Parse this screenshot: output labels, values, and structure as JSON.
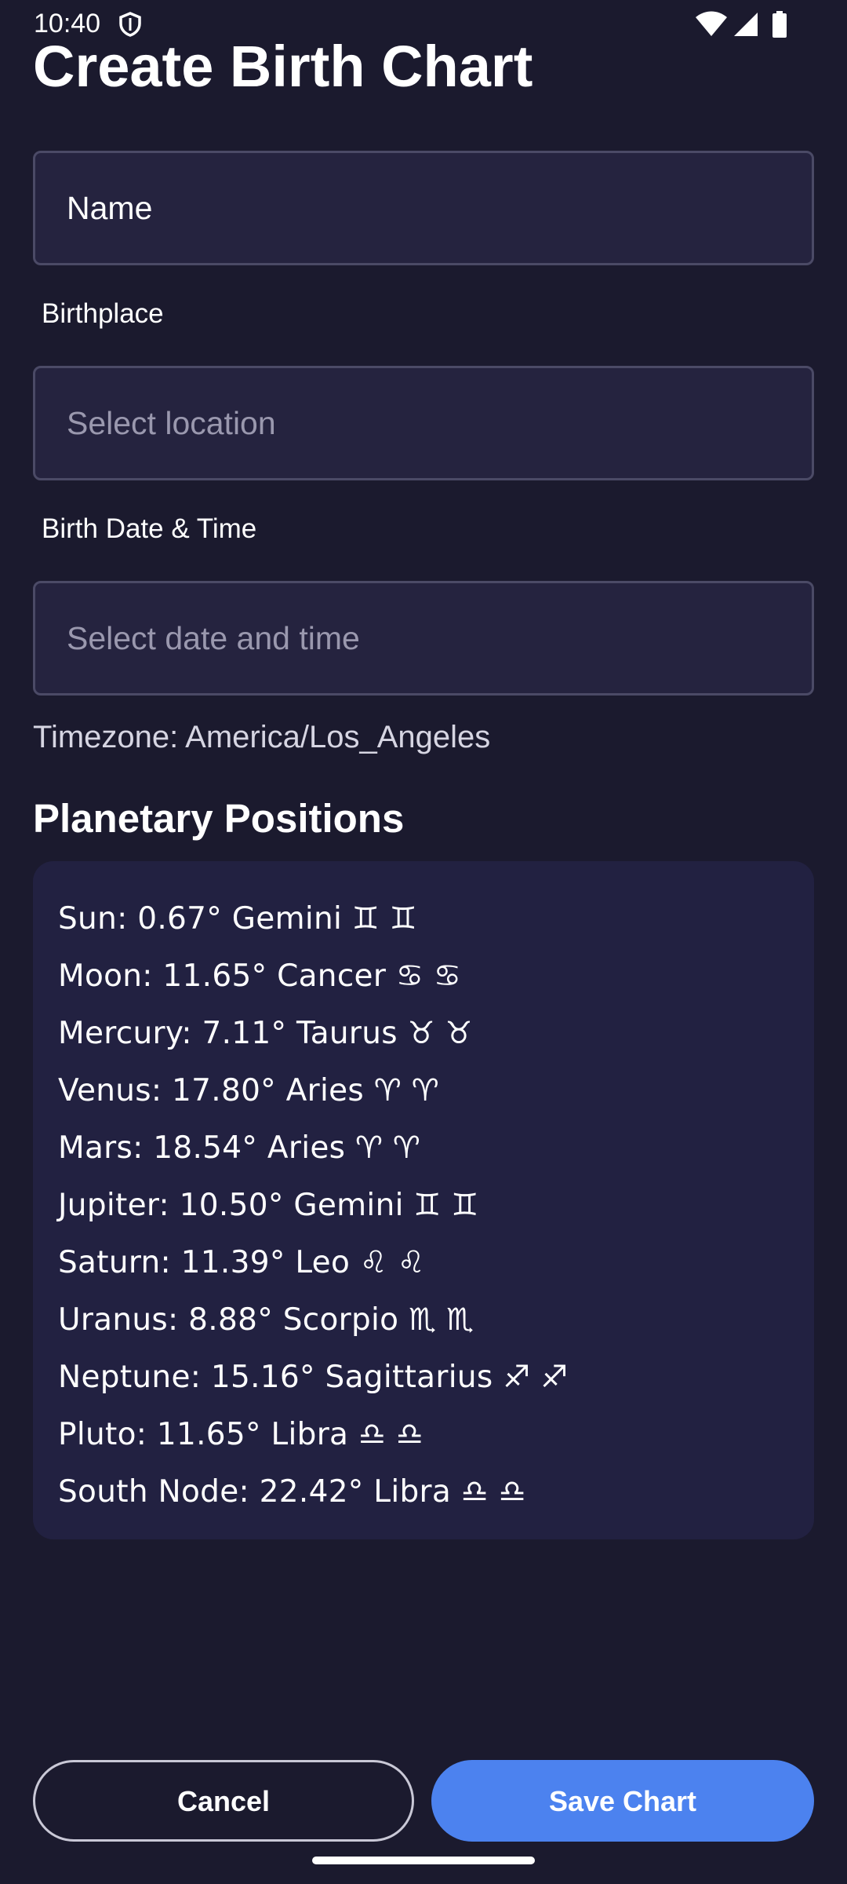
{
  "status_bar": {
    "time": "10:40",
    "icons": [
      "shield-icon",
      "wifi-icon",
      "signal-icon",
      "battery-icon"
    ]
  },
  "page_title": "Create Birth Chart",
  "form": {
    "name": {
      "value": "Name",
      "placeholder": ""
    },
    "birthplace": {
      "label": "Birthplace",
      "value": "",
      "placeholder": "Select location"
    },
    "birth_datetime": {
      "label": "Birth Date & Time",
      "value": "",
      "placeholder": "Select date and time"
    },
    "timezone_text": "Timezone: America/Los_Angeles"
  },
  "planetary_positions": {
    "title": "Planetary Positions",
    "items": [
      "Sun: 0.67° Gemini ♊︎ ♊︎",
      "Moon: 11.65° Cancer ♋︎ ♋︎",
      "Mercury: 7.11° Taurus ♉︎ ♉︎",
      "Venus: 17.80° Aries ♈︎ ♈︎",
      "Mars: 18.54° Aries ♈︎ ♈︎",
      "Jupiter: 10.50° Gemini ♊︎ ♊︎",
      "Saturn: 11.39° Leo ♌︎ ♌︎",
      "Uranus: 8.88° Scorpio ♏︎ ♏︎",
      "Neptune: 15.16° Sagittarius ♐︎ ♐︎",
      "Pluto: 11.65° Libra ♎︎ ♎︎",
      "South Node: 22.42° Libra ♎︎ ♎︎"
    ]
  },
  "actions": {
    "cancel_label": "Cancel",
    "save_label": "Save Chart"
  },
  "colors": {
    "background": "#1b1a2e",
    "field_background": "#25233f",
    "card_background": "#222141",
    "accent": "#4c82ef"
  }
}
